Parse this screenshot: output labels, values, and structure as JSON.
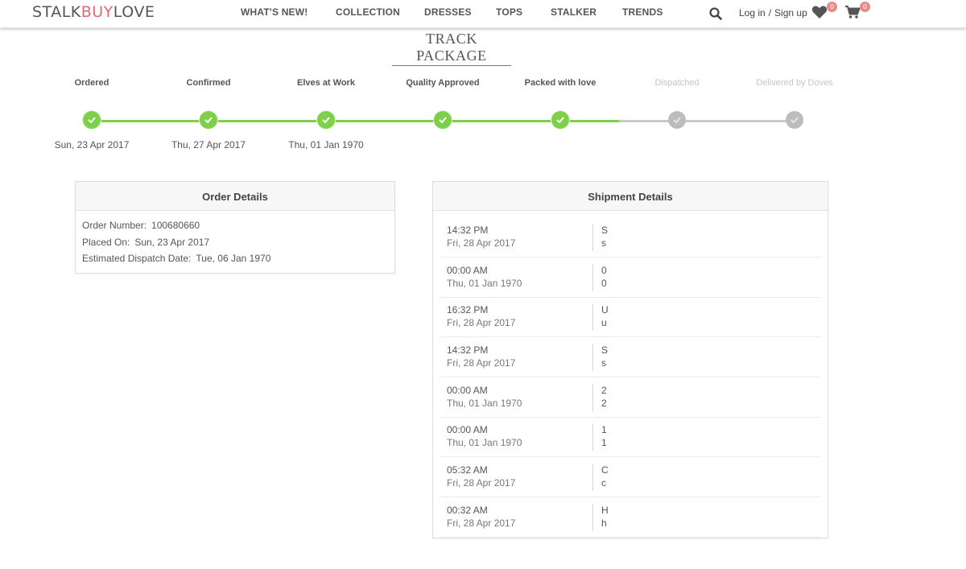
{
  "header": {
    "logo_part1": "STALK",
    "logo_part2": "BUY",
    "logo_part3": "LOVE",
    "nav": [
      "WHAT'S NEW!",
      "COLLECTION",
      "DRESSES",
      "TOPS",
      "STALKER",
      "TRENDS"
    ],
    "login_label": "Log in",
    "separator": "/",
    "signup_label": "Sign up",
    "wishlist_count": "0",
    "cart_count": "0",
    "icons": [
      "search-icon",
      "heart-icon",
      "cart-icon"
    ]
  },
  "page_title": "TRACK PACKAGE",
  "tracker": {
    "steps": [
      {
        "label": "Ordered",
        "date": "Sun, 23 Apr 2017",
        "status": "done"
      },
      {
        "label": "Confirmed",
        "date": "Thu, 27 Apr 2017",
        "status": "done"
      },
      {
        "label": "Elves at Work",
        "date": "Thu, 01 Jan 1970",
        "status": "done"
      },
      {
        "label": "Quality Approved",
        "date": "",
        "status": "done"
      },
      {
        "label": "Packed with love",
        "date": "",
        "status": "done"
      },
      {
        "label": "Dispatched",
        "date": "",
        "status": "pending"
      },
      {
        "label": "Delivered by Doves",
        "date": "",
        "status": "pending"
      }
    ]
  },
  "order_details": {
    "title": "Order Details",
    "rows": [
      {
        "label": "Order Number:",
        "value": "100680660"
      },
      {
        "label": "Placed On:",
        "value": "Sun, 23 Apr 2017"
      },
      {
        "label": "Estimated Dispatch Date:",
        "value": "Tue, 06 Jan 1970"
      }
    ]
  },
  "shipment_details": {
    "title": "Shipment Details",
    "rows": [
      {
        "time": "14:32 PM",
        "date": "Fri, 28 Apr 2017",
        "status": "S",
        "detail": "s"
      },
      {
        "time": "00:00 AM",
        "date": "Thu, 01 Jan 1970",
        "status": "0",
        "detail": "0"
      },
      {
        "time": "16:32 PM",
        "date": "Fri, 28 Apr 2017",
        "status": "U",
        "detail": "u"
      },
      {
        "time": "14:32 PM",
        "date": "Fri, 28 Apr 2017",
        "status": "S",
        "detail": "s"
      },
      {
        "time": "00:00 AM",
        "date": "Thu, 01 Jan 1970",
        "status": "2",
        "detail": "2"
      },
      {
        "time": "00:00 AM",
        "date": "Thu, 01 Jan 1970",
        "status": "1",
        "detail": "1"
      },
      {
        "time": "05:32 AM",
        "date": "Fri, 28 Apr 2017",
        "status": "C",
        "detail": "c"
      },
      {
        "time": "00:32 AM",
        "date": "Fri, 28 Apr 2017",
        "status": "H",
        "detail": "h"
      }
    ]
  },
  "colors": {
    "accent": "#e06a6f",
    "progress_done": "#7ed04b",
    "progress_pending": "#bcbcbc",
    "badge": "#e88a8a"
  }
}
